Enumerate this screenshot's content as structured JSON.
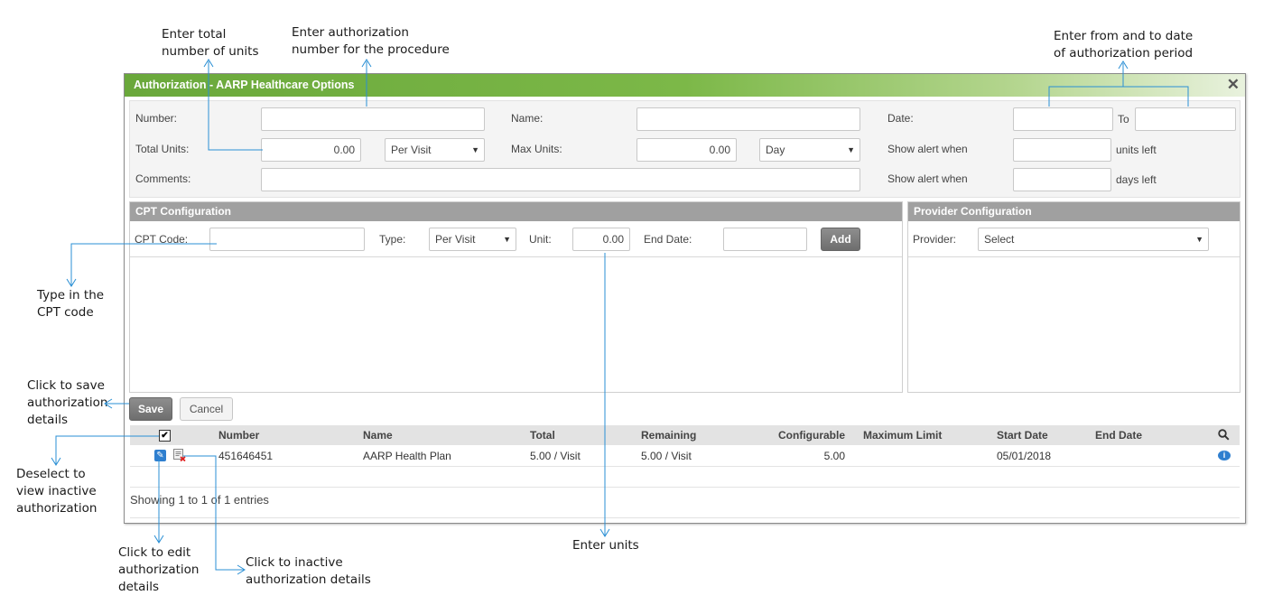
{
  "annotations": {
    "total_units": "Enter total\nnumber of units",
    "auth_number": "Enter authorization\nnumber for the procedure",
    "dates": "Enter from and to date\nof authorization period",
    "cpt_code": "Type in the\nCPT code",
    "save": "Click to save\nauthorization\ndetails",
    "deselect": "Deselect to\nview inactive\nauthorization",
    "edit": "Click to edit\nauthorization\ndetails",
    "inactivate": "Click to inactive\nauthorization details",
    "units": "Enter units"
  },
  "dialog": {
    "title": "Authorization - AARP Healthcare Options",
    "close_glyph": "✕"
  },
  "form": {
    "number_label": "Number:",
    "number_value": "",
    "name_label": "Name:",
    "name_value": "",
    "date_label": "Date:",
    "from_date": "",
    "to_label": "To",
    "to_date": "",
    "total_units_label": "Total Units:",
    "total_units_value": "0.00",
    "total_units_period": "Per Visit",
    "max_units_label": "Max Units:",
    "max_units_value": "0.00",
    "max_units_period": "Day",
    "alert_units_label": "Show alert when",
    "alert_units_value": "",
    "alert_units_suffix": "units left",
    "comments_label": "Comments:",
    "comments_value": "",
    "alert_days_label": "Show alert when",
    "alert_days_value": "",
    "alert_days_suffix": "days left"
  },
  "cpt": {
    "header": "CPT Configuration",
    "code_label": "CPT Code:",
    "code_value": "",
    "type_label": "Type:",
    "type_value": "Per Visit",
    "unit_label": "Unit:",
    "unit_value": "0.00",
    "end_date_label": "End Date:",
    "end_date_value": "",
    "add_label": "Add"
  },
  "provider": {
    "header": "Provider Configuration",
    "label": "Provider:",
    "value": "Select"
  },
  "actions": {
    "save_label": "Save",
    "cancel_label": "Cancel"
  },
  "table": {
    "show_inactive_checked": true,
    "columns": [
      "Number",
      "Name",
      "Total",
      "Remaining",
      "Configurable",
      "Maximum Limit",
      "Start Date",
      "End Date"
    ],
    "rows": [
      {
        "number": "451646451",
        "name": "AARP Health Plan",
        "total": "5.00 / Visit",
        "remaining": "5.00 / Visit",
        "configurable": "5.00",
        "maximum_limit": "",
        "start_date": "05/01/2018",
        "end_date": ""
      }
    ],
    "footer": "Showing 1 to 1 of 1 entries"
  },
  "icons": {
    "search": "search-icon",
    "edit": "pencil-icon",
    "inactivate": "document-delete-icon",
    "info": "info-bubble-icon",
    "dropdown": "chevron-down-icon"
  },
  "colors": {
    "title_green": "#6aa83b",
    "panel_header": "#a0a0a0",
    "annotation_line": "#2a8fd4",
    "icon_blue": "#2f7fcf"
  }
}
